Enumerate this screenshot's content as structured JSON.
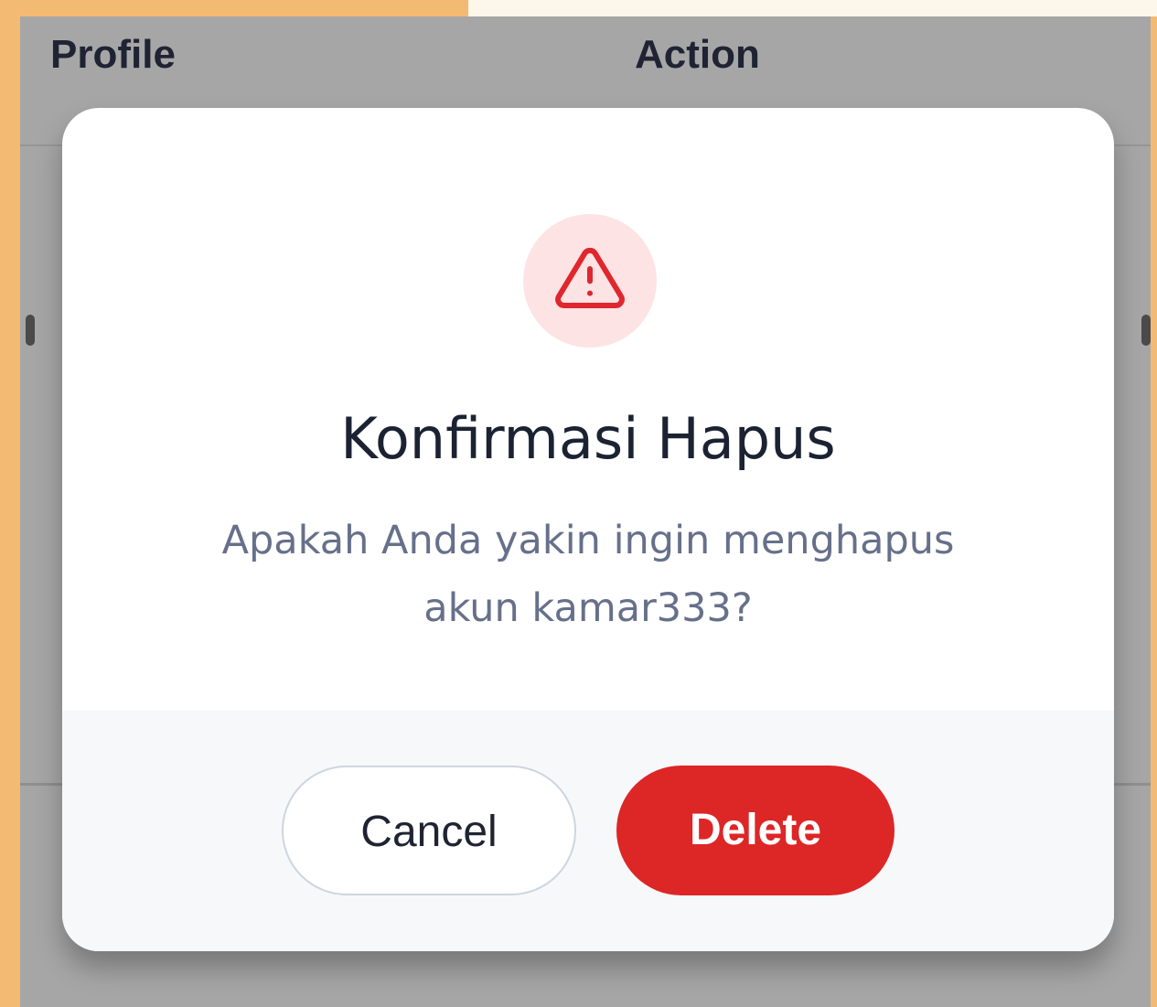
{
  "table_header": {
    "profile_label": "Profile",
    "action_label": "Action"
  },
  "dialog": {
    "icon": "warning-triangle-icon",
    "title": "Konfirmasi Hapus",
    "message": "Apakah Anda yakin ingin menghapus akun kamar333?",
    "cancel_label": "Cancel",
    "delete_label": "Delete"
  },
  "colors": {
    "background_accent": "#f3ba73",
    "overlay": "#a6a6a6",
    "danger": "#dd2626",
    "danger_light": "#fde3e3",
    "title_text": "#1b2232",
    "message_text": "#66708a"
  }
}
